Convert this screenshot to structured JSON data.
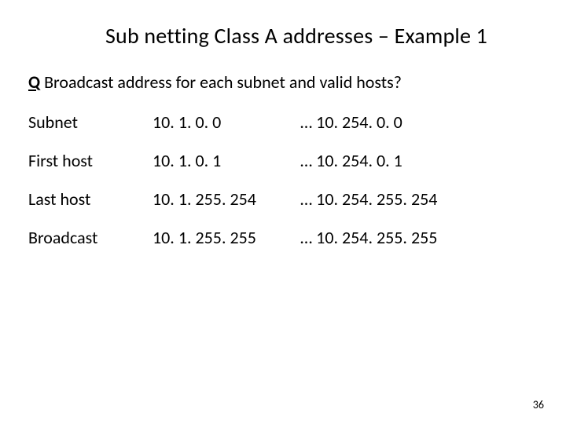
{
  "title": "Sub netting Class A addresses – Example 1",
  "question_prefix": "Q",
  "question_text": " Broadcast address for each subnet and valid hosts?",
  "rows": {
    "r0": {
      "label": "Subnet",
      "a": "10. 1. 0. 0",
      "b": "… 10. 254. 0. 0"
    },
    "r1": {
      "label": "First host",
      "a": "10. 1. 0. 1",
      "b": "… 10. 254. 0. 1"
    },
    "r2": {
      "label": "Last host",
      "a": "10. 1. 255. 254",
      "b": "… 10. 254. 255. 254"
    },
    "r3": {
      "label": "Broadcast",
      "a": "10. 1. 255. 255",
      "b": "… 10. 254. 255. 255"
    }
  },
  "page_number": "36"
}
